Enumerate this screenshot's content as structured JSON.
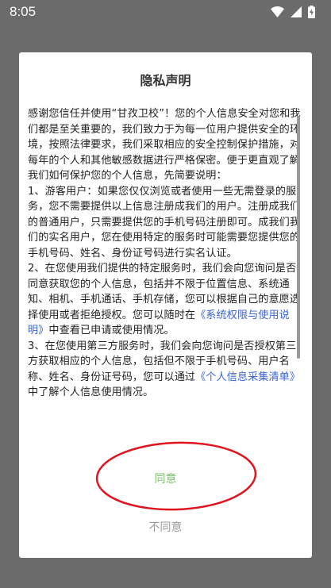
{
  "status_bar": {
    "time": "8:05",
    "icons": [
      "wifi-icon",
      "cellular-signal-icon",
      "battery-charging-icon"
    ]
  },
  "dialog": {
    "title": "隐私声明",
    "paragraph_1": "感谢您信任并使用“甘孜卫校”！您的个人信息安全对您和我们都是至关重要的，我们致力于为每一位用户提供安全的环境，按照法律要求，我们采取相应的安全控制保护措施，对每年的个人和其他敏感数据进行严格保密。便于更直观了解我们如何保护您的个人信息，先简要说明：",
    "paragraph_2": "1、游客用户：如果您仅仅浏览或者使用一些无需登录的服务，您不需要提供以上信息注册成我们的用户。注册成我们的普通用户，只需要提供您的手机号码注册即可。成我们我们的实名用户，您在使用特定的服务时可能需要您提供您的手机号码、姓名、身份证号码进行实名认证。",
    "paragraph_3_before": "2、在您使用我们提供的特定服务时，我们会向您询问是否同意获取您的个人信息，包括并不限于位置信息、系统通知、相机、手机通话、手机存储，您可以根据自己的意愿选择使用或者拒绝授权。您可以随时在",
    "paragraph_3_link": "《系统权限与使用说明》",
    "paragraph_3_after": "中查看已申请或使用情况。",
    "paragraph_4_before": "3、在您使用第三方服务时，我们会向您询问是否授权第三方获取相应的个人信息，包括但不限于手机号码、用户名称、姓名、身份证号码，您可以通过",
    "paragraph_4_link": "《个人信息采集清单》",
    "paragraph_4_after": "中了解个人信息使用情况。",
    "agree_label": "同意",
    "disagree_label": "不同意"
  },
  "colors": {
    "overlay": "#6b6b6b",
    "link": "#3a63d6",
    "agree": "#7cc36b",
    "disagree": "#9a9a9a",
    "annotation_circle": "#e0141e"
  }
}
